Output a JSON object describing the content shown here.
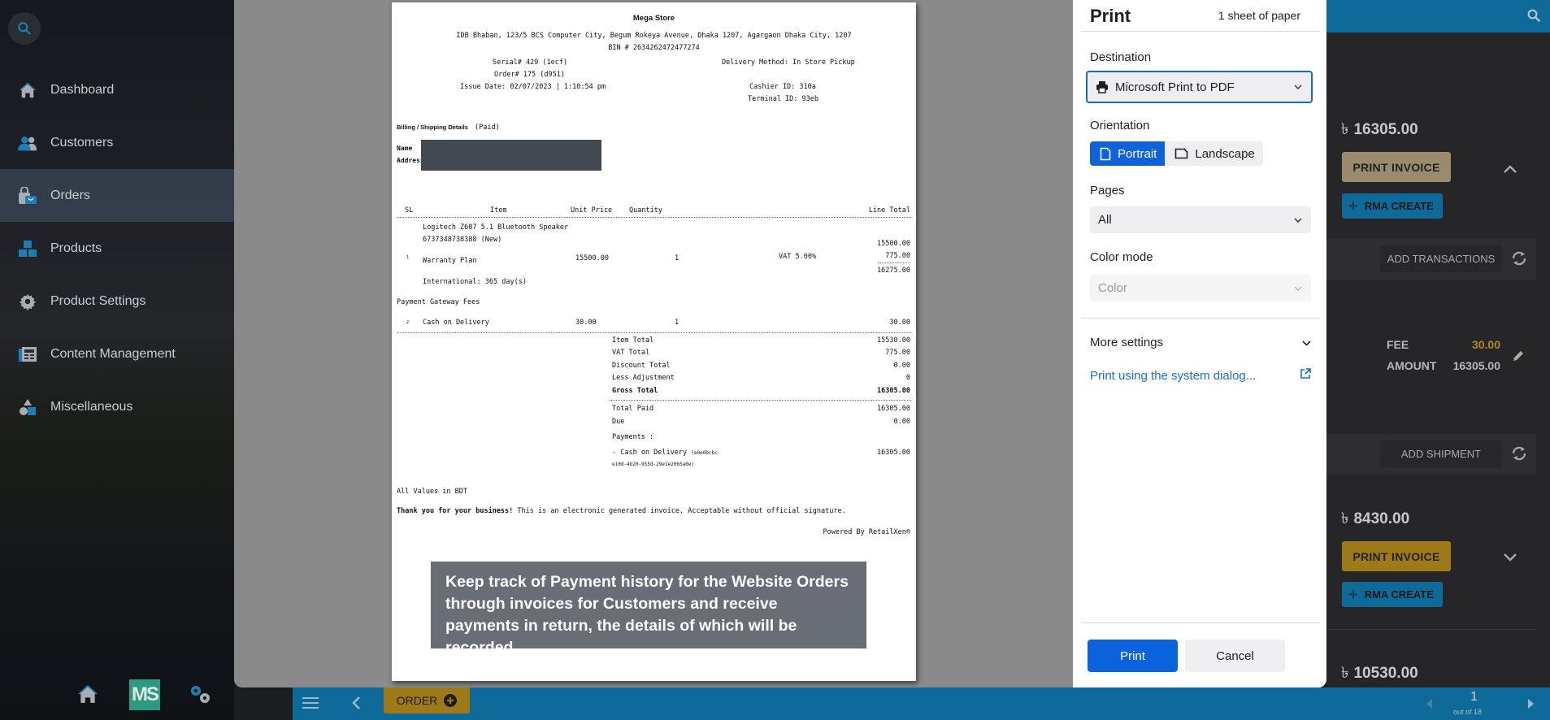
{
  "sidebar": {
    "search_icon": "search-icon",
    "items": [
      {
        "label": "Dashboard",
        "icon": "home-icon",
        "active": false
      },
      {
        "label": "Customers",
        "icon": "customers-icon",
        "active": false
      },
      {
        "label": "Orders",
        "icon": "orders-icon",
        "active": true
      },
      {
        "label": "Products",
        "icon": "products-icon",
        "active": false
      },
      {
        "label": "Product Settings",
        "icon": "gear-icon",
        "active": false
      },
      {
        "label": "Content Management",
        "icon": "content-icon",
        "active": false
      },
      {
        "label": "Miscellaneous",
        "icon": "shapes-icon",
        "active": false
      }
    ],
    "bottom": {
      "logo_text": "MS"
    }
  },
  "invoice": {
    "store_name": "Mega Store",
    "address": "IDB Bhaban, 123/5 BCS Computer City, Begum Rokeya Avenue, Dhaka 1207, Agargaon Dhaka City, 1207",
    "bin": "BIN # 2634262472477274",
    "serial": "Serial# 429 (1ecf)",
    "order": "Order# 175 (d951)",
    "issue_date": "Issue Date: 02/07/2023 | 1:10:54 pm",
    "delivery_method": "Delivery Method: In Store Pickup",
    "cashier": "Cashier ID: 310a",
    "terminal": "Terminal ID: 93eb",
    "billing_label": "Billing / Shipping Details",
    "billing_status": "(Paid)",
    "name_label": "Name",
    "address_label": "Address",
    "columns": {
      "sl": "SL",
      "item": "Item",
      "unit_price": "Unit Price",
      "quantity": "Quantity",
      "line_total": "Line Total"
    },
    "items": [
      {
        "sl": "1",
        "name": "Logitech Z607 5.1 Bluetooth Speaker",
        "sku": "6737348738388 (New)",
        "warranty": "Warranty Plan",
        "warranty_detail": "International: 365 day(s)",
        "unit_price": "15500.00",
        "quantity": "1",
        "vat_label": "VAT 5.00%",
        "subtotal": "15500.00",
        "vat": "775.00",
        "line_total": "16275.00"
      }
    ],
    "fees_heading": "Payment Gateway Fees",
    "fees": [
      {
        "sl": "2",
        "name": "Cash on Delivery",
        "unit_price": "30.00",
        "quantity": "1",
        "line_total": "30.00"
      }
    ],
    "totals": [
      {
        "label": "Item Total",
        "value": "15530.00"
      },
      {
        "label": "VAT Total",
        "value": "775.00"
      },
      {
        "label": "Discount Total",
        "value": "0.00"
      },
      {
        "label": "Less Adjustment",
        "value": "0"
      },
      {
        "label": "Gross Total",
        "value": "16305.00"
      }
    ],
    "paid": [
      {
        "label": "Total Paid",
        "value": "16305.00"
      },
      {
        "label": "Due",
        "value": "0.00"
      }
    ],
    "payments_label": "Payments :",
    "payment_line": "- Cash on Delivery",
    "payment_ref_1": "(e0e0bcbc-",
    "payment_ref_2": "e10d-4b20-955d-29e1e2065a0e)",
    "payment_amount": "16305.00",
    "currency_note": "All Values in BDT",
    "thanks_bold": "Thank you for your business!",
    "thanks_rest": " This is an electronic generated invoice. Acceptable without official signature.",
    "powered_by": "Powered By RetailXen®"
  },
  "caption": "Keep track of Payment history for the Website Orders through invoices for Customers and receive payments in return, the details of which will be recorded",
  "print_panel": {
    "title": "Print",
    "sheets": "1 sheet of paper",
    "destination_label": "Destination",
    "destination_value": "Microsoft Print to PDF",
    "orientation_label": "Orientation",
    "orientation_options": [
      "Portrait",
      "Landscape"
    ],
    "orientation_selected": "Portrait",
    "pages_label": "Pages",
    "pages_value": "All",
    "color_label": "Color mode",
    "color_value": "Color",
    "more_settings": "More settings",
    "system_dialog": "Print using the system dialog...",
    "print_button": "Print",
    "cancel_button": "Cancel",
    "accent": "#0b62dd"
  },
  "orders_panel": {
    "currency_symbol": "৳",
    "order1": {
      "amount": "16305.00",
      "print_invoice": "PRINT INVOICE",
      "rma_create": "RMA CREATE",
      "add_transactions": "ADD TRANSACTIONS",
      "fee_label": "FEE",
      "fee_value": "30.00",
      "amount_label": "AMOUNT",
      "amount_value": "16305.00",
      "add_shipment": "ADD SHIPMENT"
    },
    "order2": {
      "amount": "8430.00",
      "print_invoice": "PRINT INVOICE",
      "rma_create": "RMA CREATE"
    },
    "order3": {
      "amount": "10530.00"
    },
    "colors": {
      "print_invoice_active": "#9d7a17",
      "print_invoice_dim": "#9a8b6c",
      "rma": "#0e6b99",
      "fee": "#b08a1a"
    }
  },
  "bottom_bar": {
    "order_button": "ORDER",
    "page_current": "1",
    "page_of": "out of 18"
  }
}
